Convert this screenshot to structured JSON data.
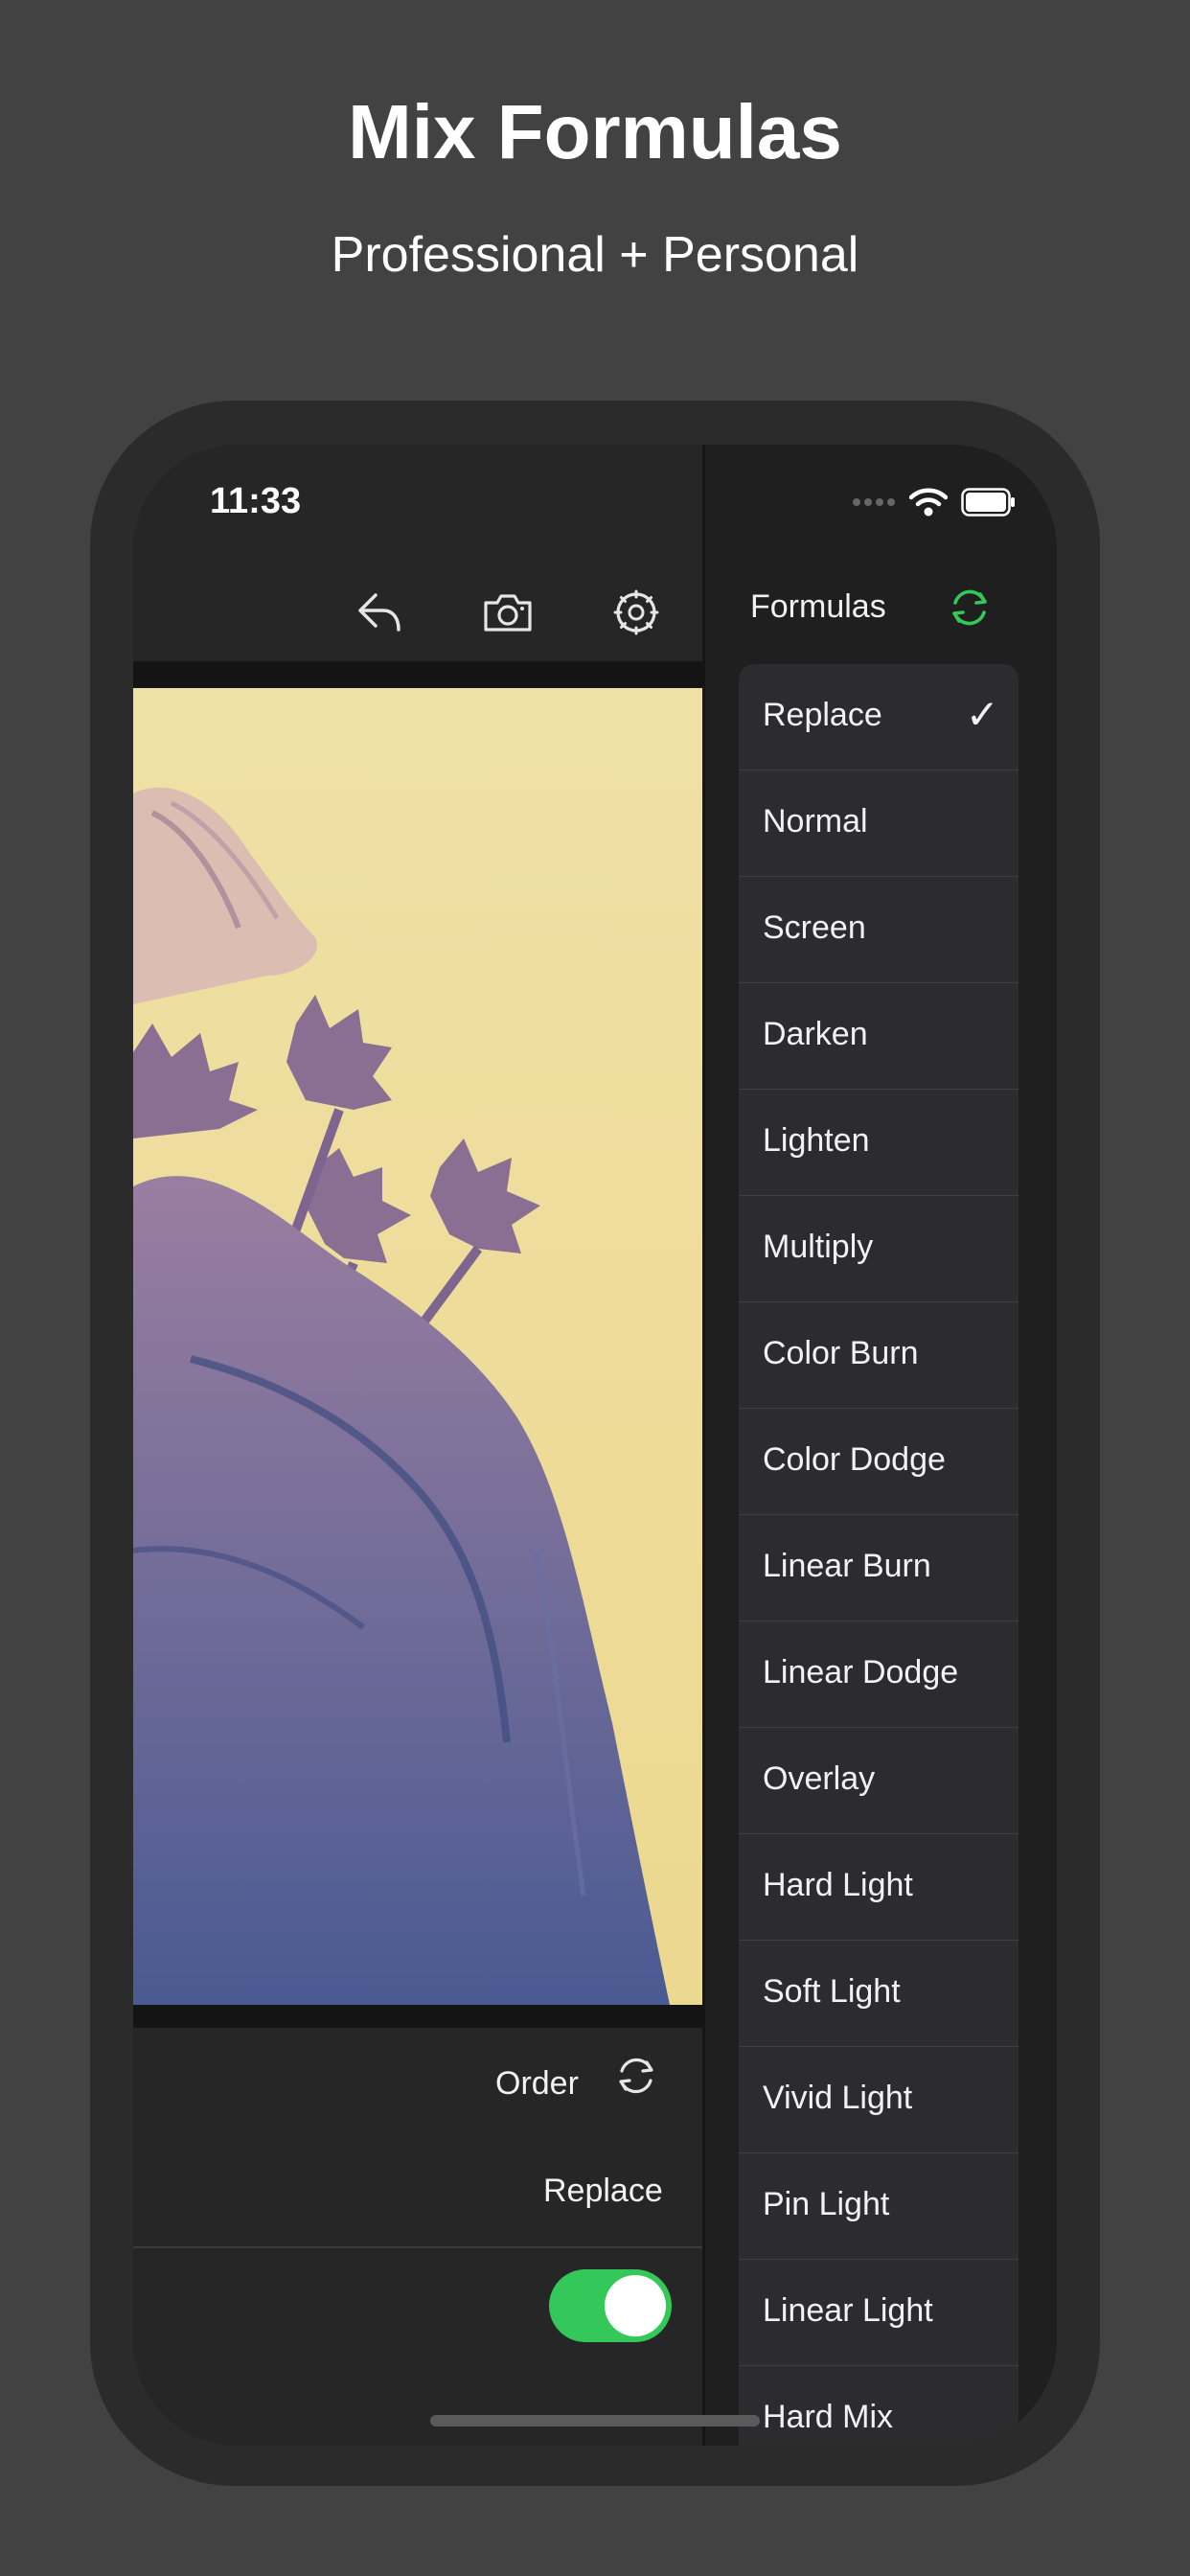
{
  "headline": "Mix Formulas",
  "subheadline": "Professional + Personal",
  "status": {
    "time": "11:33"
  },
  "toolbar": {
    "icons": [
      "undo-icon",
      "camera-icon",
      "settings-icon"
    ]
  },
  "editor": {
    "order_label": "Order",
    "blend_value": "Replace",
    "toggle_on": true
  },
  "formulas": {
    "title": "Formulas",
    "accent_color": "#34c759",
    "selected": "Replace",
    "items": [
      "Replace",
      "Normal",
      "Screen",
      "Darken",
      "Lighten",
      "Multiply",
      "Color Burn",
      "Color Dodge",
      "Linear Burn",
      "Linear Dodge",
      "Overlay",
      "Hard Light",
      "Soft Light",
      "Vivid Light",
      "Pin Light",
      "Linear Light",
      "Hard Mix"
    ]
  }
}
